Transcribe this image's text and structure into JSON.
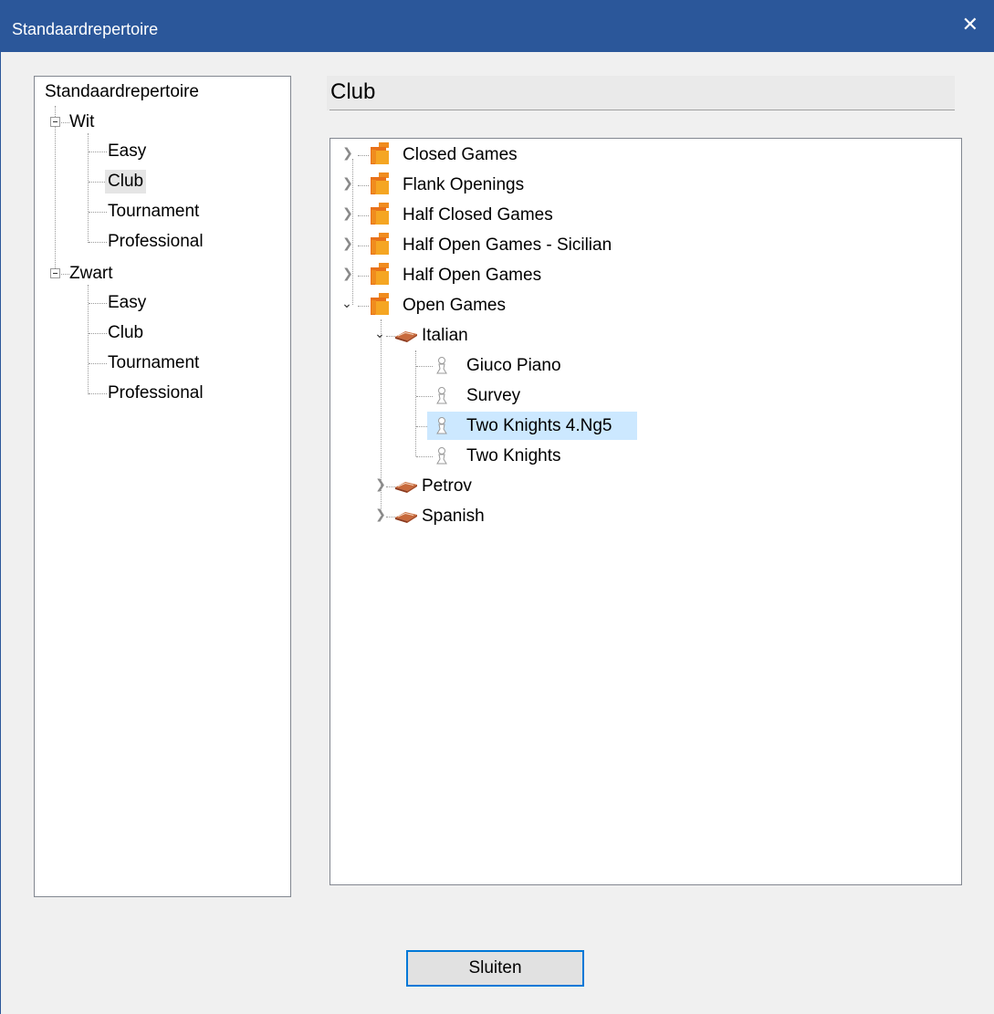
{
  "window": {
    "title": "Standaardrepertoire",
    "close_glyph": "✕"
  },
  "left_tree": {
    "root": "Standaardrepertoire",
    "groups": [
      {
        "label": "Wit",
        "children": [
          "Easy",
          "Club",
          "Tournament",
          "Professional"
        ]
      },
      {
        "label": "Zwart",
        "children": [
          "Easy",
          "Club",
          "Tournament",
          "Professional"
        ]
      }
    ],
    "selected": "Wit/Club"
  },
  "heading": {
    "title": "Club"
  },
  "right_tree": {
    "categories": [
      "Closed Games",
      "Flank Openings",
      "Half Closed Games",
      "Half Open Games - Sicilian",
      "Half Open Games",
      "Open Games"
    ],
    "open_games_children": [
      {
        "label": "Italian",
        "children": [
          "Giuco Piano",
          "Survey",
          "Two Knights 4.Ng5",
          "Two Knights"
        ]
      },
      {
        "label": "Petrov"
      },
      {
        "label": "Spanish"
      }
    ],
    "selected": "Two Knights 4.Ng5"
  },
  "footer": {
    "close_button_label": "Sluiten"
  },
  "icons": {
    "category": "stack-of-books-icon",
    "opening": "open-book-icon",
    "variation": "pawn-icon",
    "expand": "chevron-right-icon",
    "collapse": "chevron-down-icon"
  },
  "colors": {
    "titlebar": "#2b579a",
    "selection": "#cce8ff",
    "folder_orange": "#f08c1e"
  }
}
